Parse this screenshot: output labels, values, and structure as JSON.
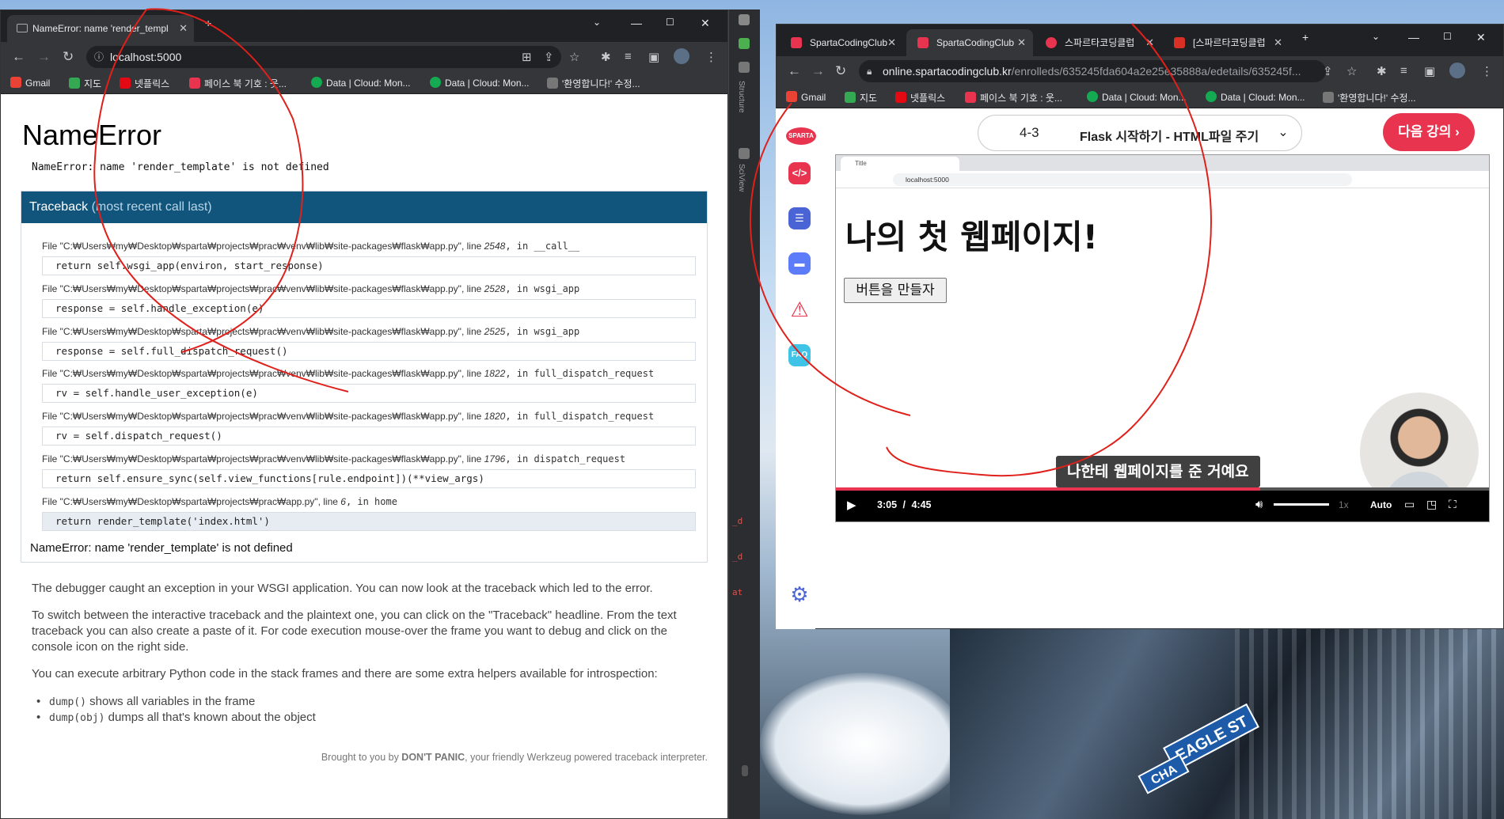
{
  "left_browser": {
    "tab_title": "NameError: name 'render_templ",
    "url": "localhost:5000",
    "bookmarks": [
      "Gmail",
      "지도",
      "넷플릭스",
      "페이스 북 기호 : 웃...",
      "Data | Cloud: Mon...",
      "Data | Cloud: Mon...",
      "'환영합니다!' 수정..."
    ]
  },
  "werkzeug": {
    "title": "NameError",
    "subtitle": "NameError: name 'render_template' is not defined",
    "traceback_label": "Traceback",
    "traceback_sub": "(most recent call last)",
    "frames": [
      {
        "file": "File \"C:₩Users₩my₩Desktop₩sparta₩projects₩prac₩venv₩lib₩site-packages₩flask₩app.py\", line ",
        "line": "2548",
        "func": ", in __call__",
        "code": "return self.wsgi_app(environ, start_response)"
      },
      {
        "file": "File \"C:₩Users₩my₩Desktop₩sparta₩projects₩prac₩venv₩lib₩site-packages₩flask₩app.py\", line ",
        "line": "2528",
        "func": ", in wsgi_app",
        "code": "response = self.handle_exception(e)"
      },
      {
        "file": "File \"C:₩Users₩my₩Desktop₩sparta₩projects₩prac₩venv₩lib₩site-packages₩flask₩app.py\", line ",
        "line": "2525",
        "func": ", in wsgi_app",
        "code": "response = self.full_dispatch_request()"
      },
      {
        "file": "File \"C:₩Users₩my₩Desktop₩sparta₩projects₩prac₩venv₩lib₩site-packages₩flask₩app.py\", line ",
        "line": "1822",
        "func": ", in full_dispatch_request",
        "code": "rv = self.handle_user_exception(e)"
      },
      {
        "file": "File \"C:₩Users₩my₩Desktop₩sparta₩projects₩prac₩venv₩lib₩site-packages₩flask₩app.py\", line ",
        "line": "1820",
        "func": ", in full_dispatch_request",
        "code": "rv = self.dispatch_request()"
      },
      {
        "file": "File \"C:₩Users₩my₩Desktop₩sparta₩projects₩prac₩venv₩lib₩site-packages₩flask₩app.py\", line ",
        "line": "1796",
        "func": ", in dispatch_request",
        "code": "return self.ensure_sync(self.view_functions[rule.endpoint])(**view_args)"
      },
      {
        "file": "File \"C:₩Users₩my₩Desktop₩sparta₩projects₩prac₩app.py\", line ",
        "line": "6",
        "func": ", in home",
        "code": "return render_template('index.html')"
      }
    ],
    "final_error": "NameError: name 'render_template' is not defined",
    "p1": "The debugger caught an exception in your WSGI application. You can now look at the traceback which led to the error.",
    "p2": "To switch between the interactive traceback and the plaintext one, you can click on the \"Traceback\" headline. From the text traceback you can also create a paste of it. For code execution mouse-over the frame you want to debug and click on the console icon on the right side.",
    "p3": "You can execute arbitrary Python code in the stack frames and there are some extra helpers available for introspection:",
    "helper1_code": "dump()",
    "helper1_text": " shows all variables in the frame",
    "helper2_code": "dump(obj)",
    "helper2_text": " dumps all that's known about the object",
    "footer_pre": "Brought to you by ",
    "footer_bold": "DON'T PANIC",
    "footer_post": ", your friendly Werkzeug powered traceback interpreter."
  },
  "ide": {
    "red_labels": [
      "_d",
      "_d",
      "at"
    ],
    "vtext1": "Structure",
    "vtext2": "SciView"
  },
  "right_browser": {
    "tabs": [
      "SpartaCodingClub",
      "SpartaCodingClub",
      "스파르타코딩클럽",
      "[스파르타코딩클럽"
    ],
    "url_host": "online.spartacodingclub.kr",
    "url_path": "/enrolleds/635245fda604a2e25e35888a/edetails/635245f...",
    "bookmarks": [
      "Gmail",
      "지도",
      "넷플릭스",
      "페이스 북 기호 : 웃...",
      "Data | Cloud: Mon...",
      "Data | Cloud: Mon...",
      "'환영합니다!' 수정..."
    ]
  },
  "sparta": {
    "logo": "SPARTA",
    "lesson_num": "4-3",
    "lesson_title": "Flask 시작하기 - HTML파일 주기",
    "next_button": "다음 강의",
    "faq_label": "FAQ"
  },
  "video": {
    "tab_title": "Title",
    "url": "localhost:5000",
    "heading": "나의 첫 웹페이지!",
    "button": "버튼을 만들자",
    "caption": "나한테 웹페이지를 준 거예요",
    "current_time": "3:05",
    "separator": "/",
    "duration": "4:45",
    "progress": 0.65,
    "speed": "1x",
    "quality": "Auto"
  },
  "wallpaper": {
    "sign1": "EAGLE ST",
    "sign2": "CHA"
  },
  "colors": {
    "werkzeug_header": "#11557c",
    "sparta_red": "#e8344e",
    "annotation_red": "#e0201b"
  }
}
